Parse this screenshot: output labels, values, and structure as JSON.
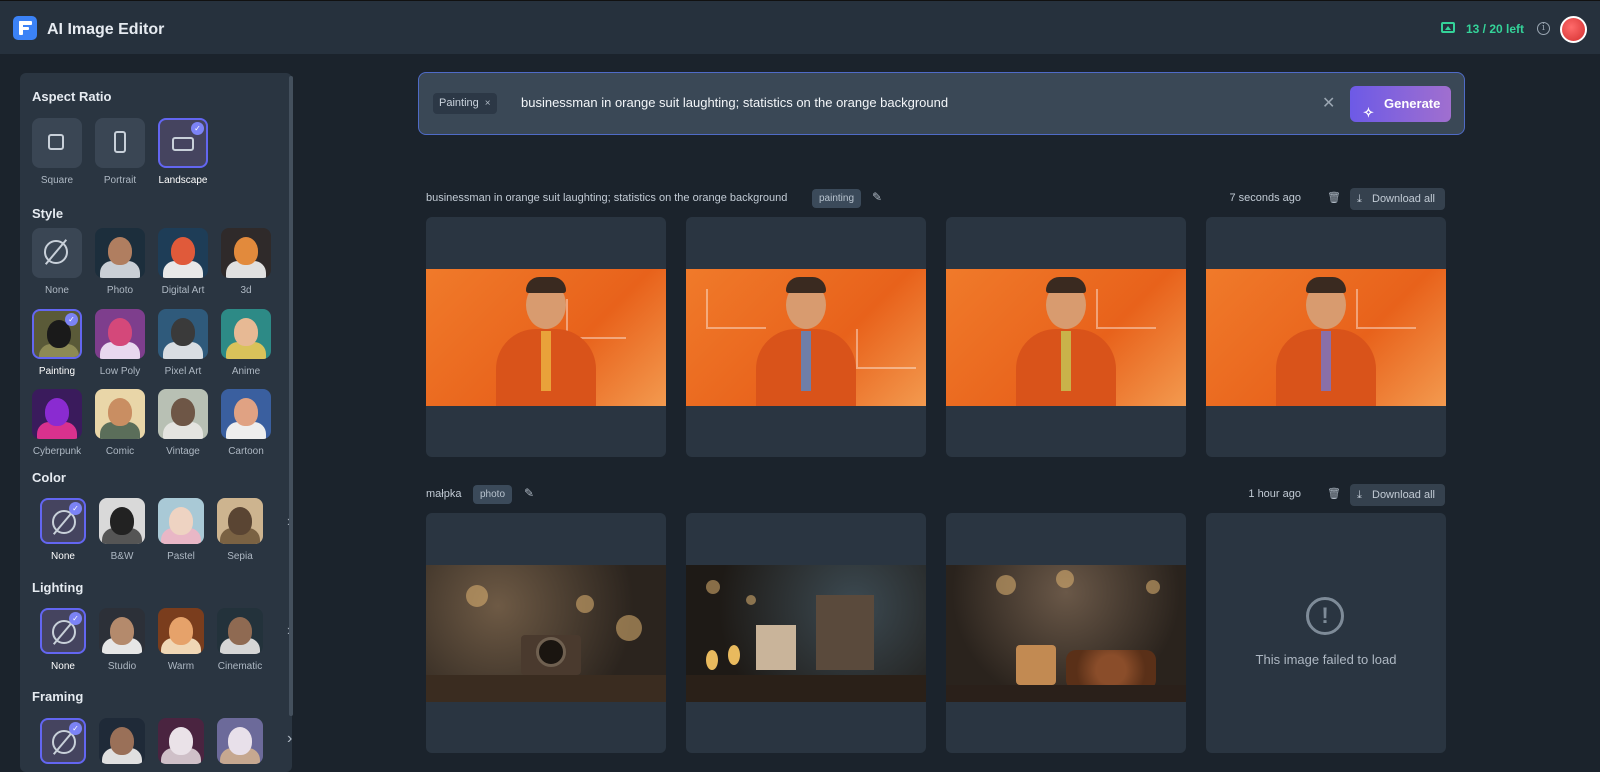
{
  "header": {
    "app_title": "AI Image Editor",
    "credits": "13 / 20 left",
    "info_glyph": "i"
  },
  "sidebar": {
    "aspect_ratio": {
      "title": "Aspect Ratio",
      "options": [
        {
          "label": "Square",
          "icon": "square-icon"
        },
        {
          "label": "Portrait",
          "icon": "portrait-icon"
        },
        {
          "label": "Landscape",
          "icon": "landscape-icon",
          "selected": true
        }
      ]
    },
    "style": {
      "title": "Style",
      "options": [
        {
          "label": "None"
        },
        {
          "label": "Photo"
        },
        {
          "label": "Digital Art"
        },
        {
          "label": "3d"
        },
        {
          "label": "Painting",
          "selected": true
        },
        {
          "label": "Low Poly"
        },
        {
          "label": "Pixel Art"
        },
        {
          "label": "Anime"
        },
        {
          "label": "Cyberpunk"
        },
        {
          "label": "Comic"
        },
        {
          "label": "Vintage"
        },
        {
          "label": "Cartoon"
        }
      ]
    },
    "color": {
      "title": "Color",
      "options": [
        {
          "label": "None",
          "selected": true
        },
        {
          "label": "B&W"
        },
        {
          "label": "Pastel"
        },
        {
          "label": "Sepia"
        }
      ]
    },
    "lighting": {
      "title": "Lighting",
      "options": [
        {
          "label": "None",
          "selected": true
        },
        {
          "label": "Studio"
        },
        {
          "label": "Warm"
        },
        {
          "label": "Cinematic"
        }
      ]
    },
    "framing": {
      "title": "Framing",
      "options": [
        {
          "label": "None",
          "selected": true
        },
        {
          "label": ""
        },
        {
          "label": ""
        },
        {
          "label": ""
        }
      ]
    }
  },
  "prompt_bar": {
    "style_chip": "Painting",
    "chip_remove": "×",
    "prompt": "businessman in orange suit laughting; statistics on the orange background",
    "clear": "✕",
    "generate_label": "Generate"
  },
  "groups": [
    {
      "prompt": "businessman in orange suit laughting; statistics on the orange background",
      "tag": "painting",
      "time": "7 seconds ago",
      "download_label": "Download all"
    },
    {
      "prompt": "małpka",
      "tag": "photo",
      "time": "1 hour ago",
      "download_label": "Download all",
      "failed_text": "This image failed to load"
    }
  ],
  "colors": {
    "accent": "#6366f1",
    "credits": "#34d399",
    "generate_start": "#6d5ae6",
    "generate_end": "#a06fcf"
  }
}
